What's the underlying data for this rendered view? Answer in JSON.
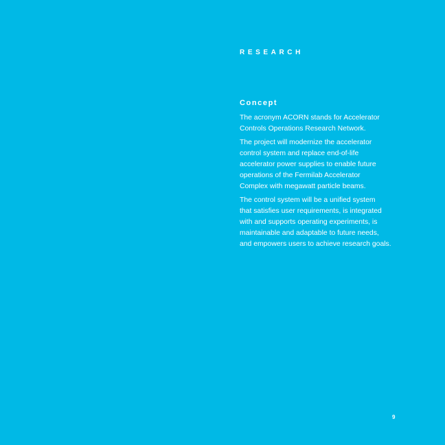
{
  "page": {
    "background_color": "#00b9e6",
    "text_color": "#ffffff",
    "section_label": "RESEARCH",
    "heading": "Concept",
    "paragraphs": [
      {
        "lines": [
          "The acronym ACORN stands for Accelerator",
          "Controls Operations Research Network."
        ]
      },
      {
        "lines": [
          "The project will modernize the accelerator",
          "control system and replace end-of-life",
          "accelerator power supplies to enable future",
          "operations of the Fermilab Accelerator",
          "Complex with megawatt particle beams."
        ]
      },
      {
        "lines": [
          "The control system will be a unified system",
          "that satisfies user requirements, is integrated",
          "with and supports operating experiments, is",
          "maintainable and adaptable to future needs,",
          "and empowers users to achieve research goals."
        ]
      }
    ],
    "page_number": "9"
  }
}
